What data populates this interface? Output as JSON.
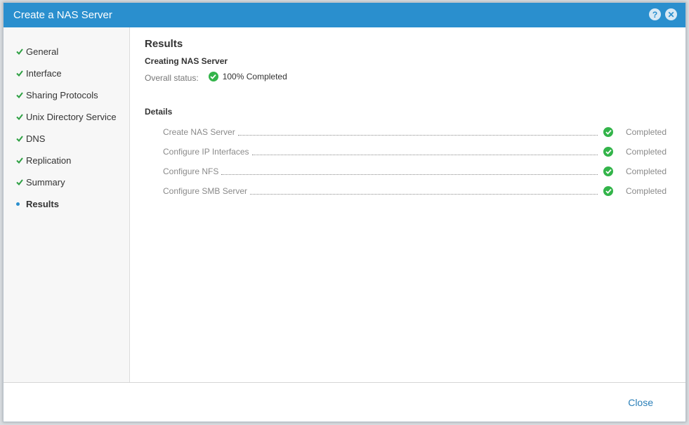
{
  "dialog": {
    "title": "Create a NAS Server",
    "help_icon": "help-icon",
    "close_icon": "close-icon",
    "help_glyph": "?",
    "close_glyph": "✕"
  },
  "steps": [
    {
      "label": "General",
      "state": "done"
    },
    {
      "label": "Interface",
      "state": "done"
    },
    {
      "label": "Sharing Protocols",
      "state": "done"
    },
    {
      "label": "Unix Directory Service",
      "state": "done"
    },
    {
      "label": "DNS",
      "state": "done"
    },
    {
      "label": "Replication",
      "state": "done"
    },
    {
      "label": "Summary",
      "state": "done"
    },
    {
      "label": "Results",
      "state": "active"
    }
  ],
  "results": {
    "heading": "Results",
    "subheading": "Creating NAS Server",
    "overall_label": "Overall status:",
    "overall_value": "100% Completed",
    "details_heading": "Details",
    "details": [
      {
        "name": "Create NAS Server",
        "status": "Completed"
      },
      {
        "name": "Configure IP Interfaces",
        "status": "Completed"
      },
      {
        "name": "Configure NFS",
        "status": "Completed"
      },
      {
        "name": "Configure SMB Server",
        "status": "Completed"
      }
    ]
  },
  "footer": {
    "close_label": "Close"
  },
  "colors": {
    "titlebar": "#2a8fce",
    "check_green": "#33b44a",
    "link_blue": "#2a7fb8"
  }
}
